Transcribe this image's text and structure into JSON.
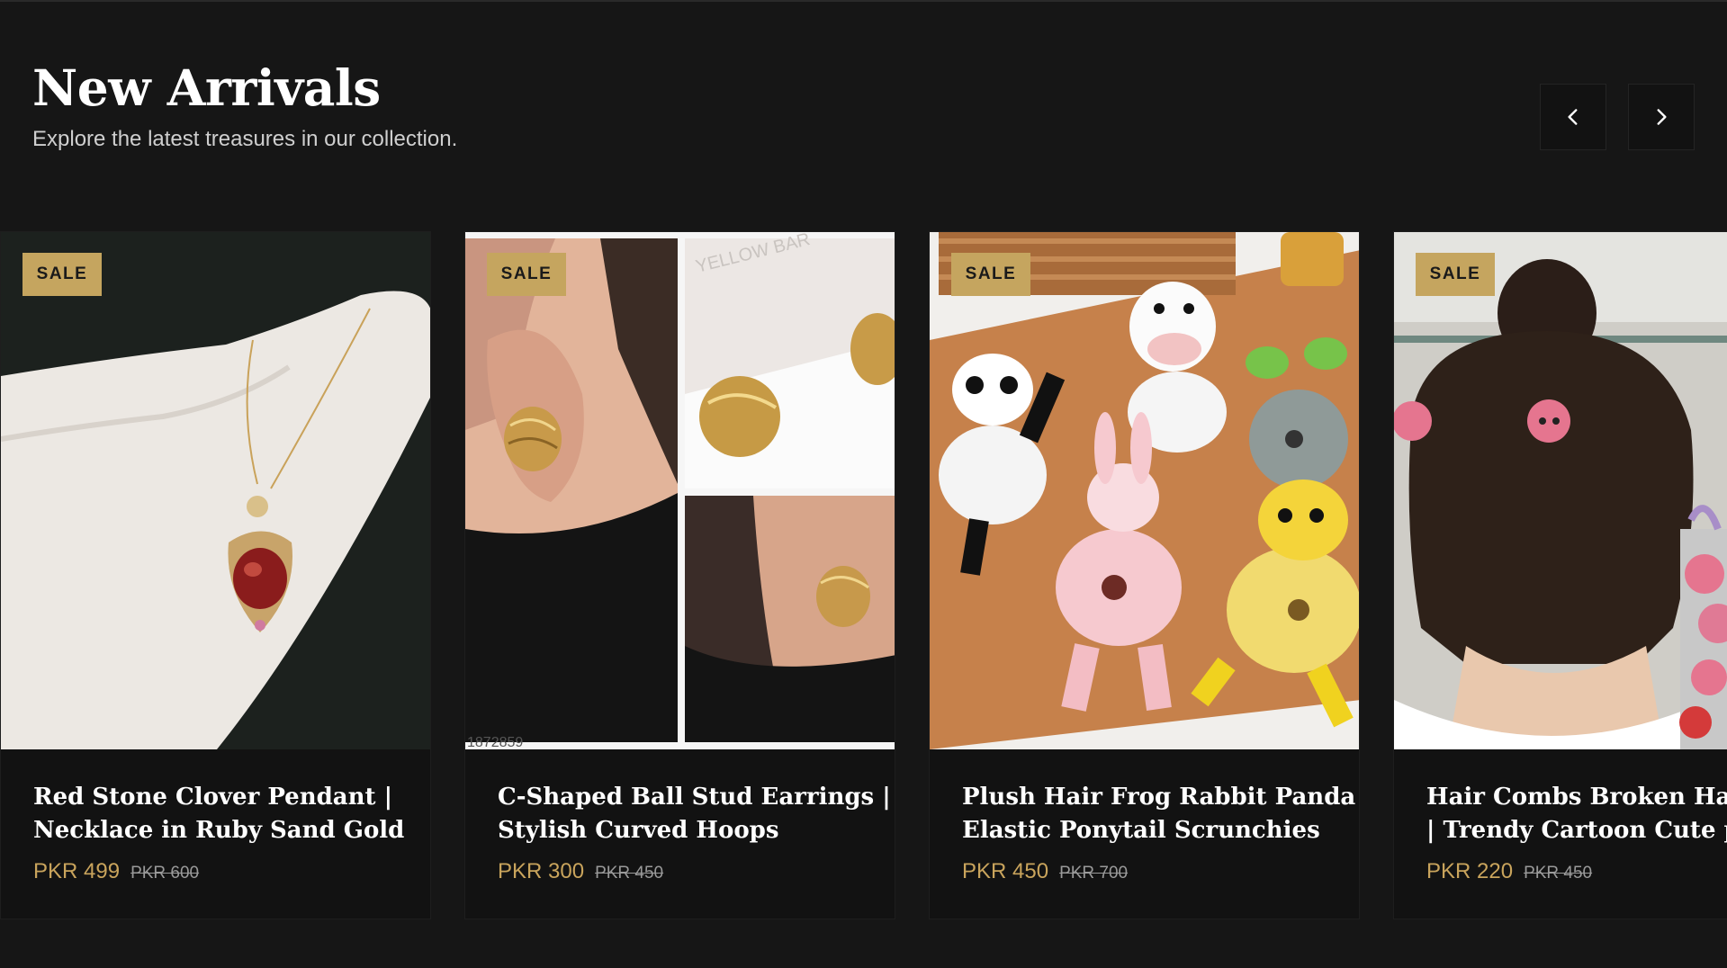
{
  "section": {
    "title": "New Arrivals",
    "subtitle": "Explore the latest treasures in our collection."
  },
  "nav": {
    "prev_icon": "chevron-left-icon",
    "next_icon": "chevron-right-icon"
  },
  "colors": {
    "background": "#161616",
    "card": "#121212",
    "accent_gold": "#c5a55f",
    "price": "#c9a45c"
  },
  "products": [
    {
      "badge": "SALE",
      "title_line1": "Red Stone Clover Pendant |",
      "title_line2": "Necklace in Ruby Sand Gold",
      "price": "PKR 499",
      "old_price": "PKR 600"
    },
    {
      "badge": "SALE",
      "title_line1": "C-Shaped Ball Stud Earrings |",
      "title_line2": "Stylish Curved Hoops",
      "price": "PKR 300",
      "old_price": "PKR 450",
      "image_text_sign": "YELLOW BAR",
      "image_text_code": "1872859"
    },
    {
      "badge": "SALE",
      "title_line1": "Plush Hair Frog Rabbit Panda",
      "title_line2": "Elastic Ponytail Scrunchies",
      "price": "PKR 450",
      "old_price": "PKR 700"
    },
    {
      "badge": "SALE",
      "title_line1": "Hair Combs Broken Hair C",
      "title_line2": "| Trendy Cartoon Cute pin",
      "price": "PKR 220",
      "old_price": "PKR 450"
    }
  ]
}
